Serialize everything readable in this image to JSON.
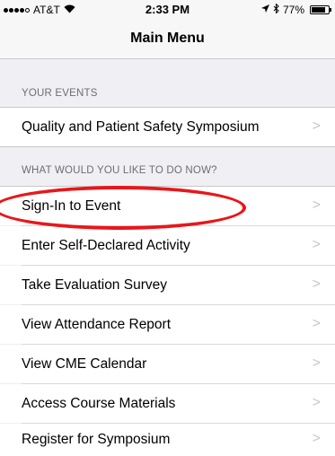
{
  "status_bar": {
    "carrier": "AT&T",
    "time": "2:33 PM",
    "battery": "77%",
    "icons": [
      "signal-icon",
      "wifi-icon",
      "location-arrow-icon",
      "bluetooth-icon",
      "battery-icon"
    ]
  },
  "nav": {
    "title": "Main Menu"
  },
  "your_events": {
    "header": "YOUR EVENTS",
    "items": [
      {
        "label": "Quality and Patient Safety Symposium"
      }
    ]
  },
  "actions": {
    "header": "WHAT WOULD YOU LIKE TO DO NOW?",
    "items": [
      {
        "label": "Sign-In to Event"
      },
      {
        "label": "Enter Self-Declared Activity"
      },
      {
        "label": "Take Evaluation Survey"
      },
      {
        "label": "View Attendance Report"
      },
      {
        "label": "View CME Calendar"
      },
      {
        "label": "Access Course Materials"
      },
      {
        "label": "Register for Symposium"
      }
    ]
  },
  "chevron_glyph": ">",
  "colors": {
    "background": "#efeff4",
    "highlight": "#e8171b",
    "chevron": "#c7c7cc"
  }
}
